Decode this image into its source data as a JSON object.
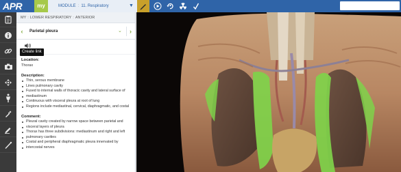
{
  "header": {
    "logo": "APR",
    "my_tab": "my",
    "module_label": "MODULE",
    "module_separator": ":",
    "module_name": "11. Respiratory",
    "accent_color": "#2f64a8",
    "active_tool_color": "#c8a02a",
    "tools": [
      "pencil-icon",
      "play-icon",
      "rotate-view-icon",
      "radiation-icon",
      "checkmark-icon"
    ]
  },
  "sidebar": {
    "items": [
      "clipboard-icon",
      "info-icon",
      "link-icon",
      "camera-icon",
      "move-icon",
      "body-icon",
      "pipette-icon",
      "pencil-icon",
      "line-tool-icon"
    ]
  },
  "tooltip": {
    "text": "Create link"
  },
  "panel": {
    "breadcrumb": [
      "MY",
      "LOWER RESPIRATORY",
      "ANTERIOR"
    ],
    "structure_name": "Parietal pleura",
    "location": {
      "title": "Location:",
      "text": "Thorax"
    },
    "description": {
      "title": "Description:",
      "items": [
        "Thin, serous membrane",
        "Lines pulmonary cavity",
        "Fused to internal walls of thoracic cavity and lateral surface of",
        "mediastinum",
        "Continuous with visceral pleura at root of lung",
        "Regions include mediastinal, cervical, diaphragmatic, and costal"
      ]
    },
    "comment": {
      "title": "Comment:",
      "items": [
        "Pleural cavity created by narrow space between parietal and",
        "visceral layers of pleura",
        "Thorax has three subdivisions: mediastinum and right and left",
        "pulmonary cavities",
        "Costal and peripheral diaphragmatic pleura innervated by",
        "intercostal nerves"
      ]
    }
  },
  "viewer": {
    "highlight_color": "#7fd24a"
  }
}
